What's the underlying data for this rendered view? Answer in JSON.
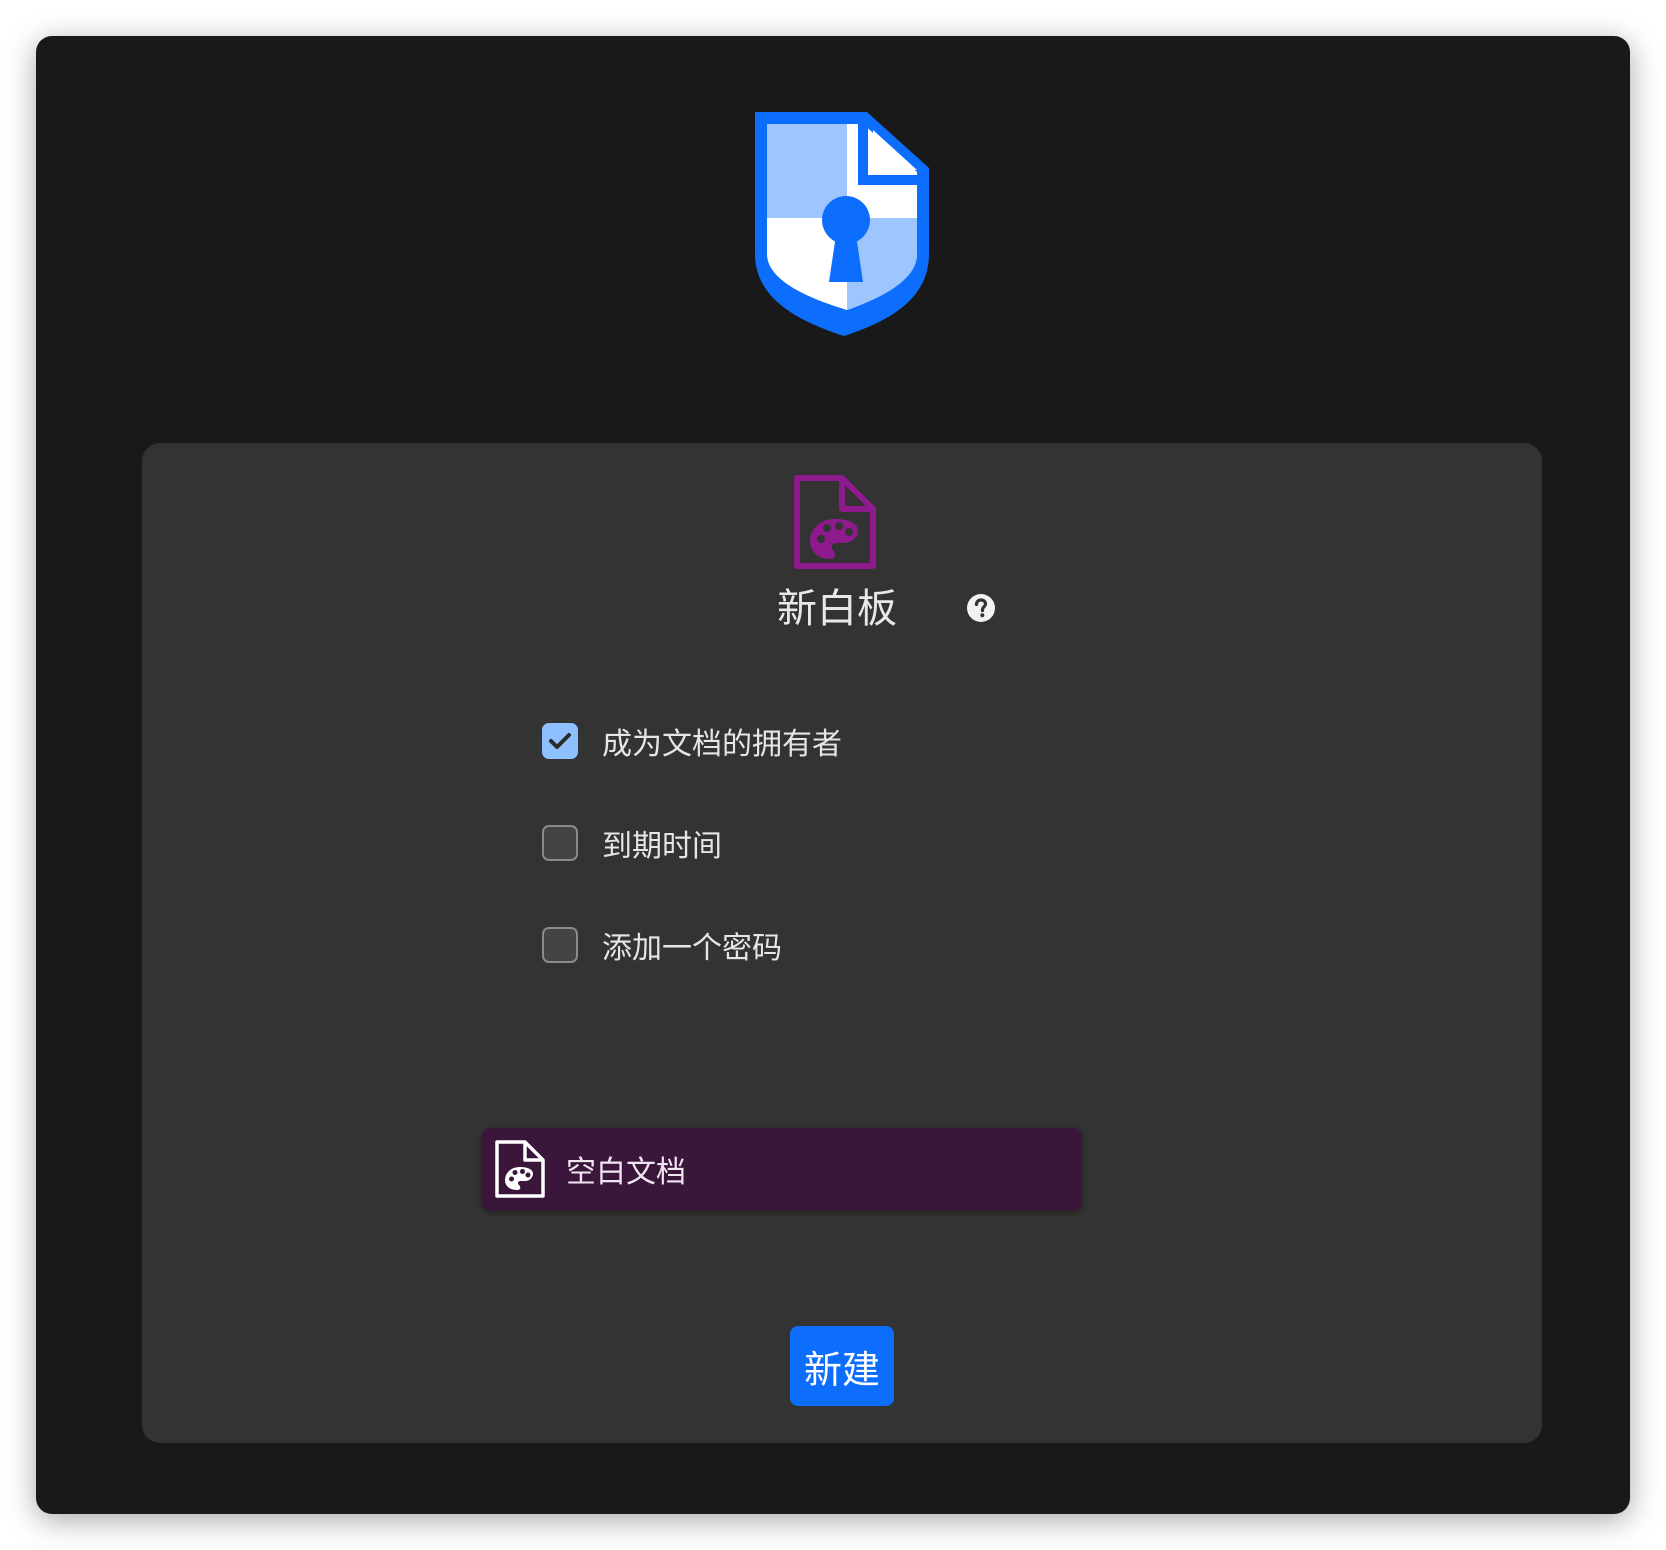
{
  "logo": {
    "icon": "shield-keyhole-logo",
    "primary_color": "#0d6efd",
    "light_color": "#9ec5fe"
  },
  "panel": {
    "type_icon": "file-palette-icon",
    "type_icon_color": "#8e1a8e",
    "title": "新白板",
    "help_icon": "question-circle-icon",
    "options": [
      {
        "label": "成为文档的拥有者",
        "checked": true
      },
      {
        "label": "到期时间",
        "checked": false
      },
      {
        "label": "添加一个密码",
        "checked": false
      }
    ],
    "template": {
      "icon": "file-palette-icon",
      "label": "空白文档",
      "selected": true
    },
    "create_label": "新建",
    "accent_color": "#0d6efd"
  }
}
